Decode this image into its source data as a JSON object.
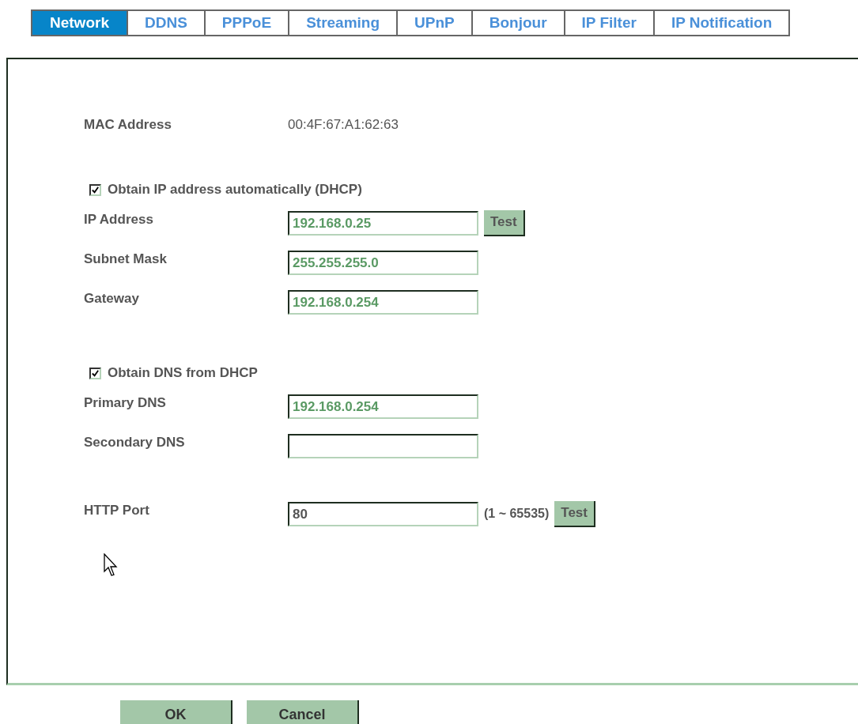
{
  "tabs": [
    {
      "label": "Network",
      "selected": true
    },
    {
      "label": "DDNS",
      "selected": false
    },
    {
      "label": "PPPoE",
      "selected": false
    },
    {
      "label": "Streaming",
      "selected": false
    },
    {
      "label": "UPnP",
      "selected": false
    },
    {
      "label": "Bonjour",
      "selected": false
    },
    {
      "label": "IP Filter",
      "selected": false
    },
    {
      "label": "IP Notification",
      "selected": false
    }
  ],
  "sections": [
    {
      "rows": [
        {
          "kind": "info",
          "label": "MAC Address",
          "value": "00:4F:67:A1:62:63"
        }
      ]
    },
    {
      "rows": [
        {
          "kind": "checkbox",
          "label": "Obtain IP address automatically (DHCP)",
          "checked": true
        },
        {
          "kind": "field",
          "label": "IP Address",
          "value": "192.168.0.25",
          "filled_by_dhcp": true,
          "button": "Test"
        },
        {
          "kind": "field",
          "label": "Subnet Mask",
          "value": "255.255.255.0",
          "filled_by_dhcp": true
        },
        {
          "kind": "field",
          "label": "Gateway",
          "value": "192.168.0.254",
          "filled_by_dhcp": true
        }
      ]
    },
    {
      "rows": [
        {
          "kind": "checkbox",
          "label": "Obtain DNS from DHCP",
          "checked": true
        },
        {
          "kind": "field",
          "label": "Primary DNS",
          "value": "192.168.0.254",
          "filled_by_dhcp": true
        },
        {
          "kind": "field",
          "label": "Secondary DNS"
        }
      ]
    },
    {
      "rows": [
        {
          "kind": "field",
          "label": "HTTP Port",
          "value": "80",
          "filled_by_dhcp": false,
          "hint": "(**1** ~ 65535)",
          "button": "Test"
        }
      ]
    }
  ],
  "buttons": [
    "OK",
    "Cancel"
  ]
}
